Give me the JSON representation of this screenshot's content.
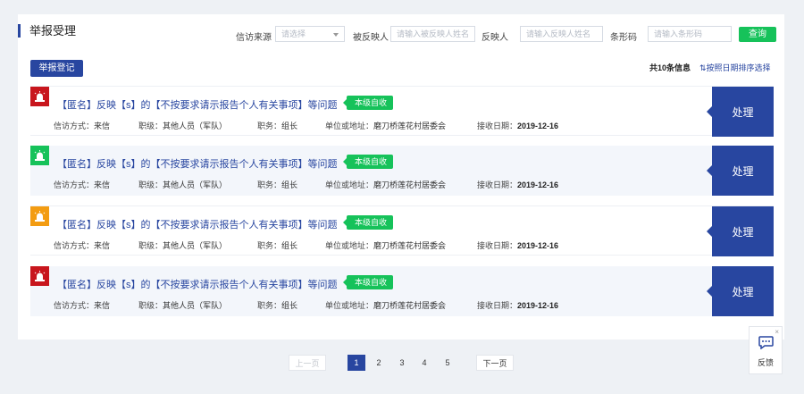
{
  "header": {
    "title": "举报受理"
  },
  "filters": {
    "source_label": "信访来源",
    "source_placeholder": "请选择",
    "reported_label": "被反映人",
    "reported_placeholder": "请输入被反映人姓名",
    "reporter_label": "反映人",
    "reporter_placeholder": "请输入反映人姓名",
    "barcode_label": "条形码",
    "barcode_placeholder": "请输入条形码",
    "query_label": "查询"
  },
  "toolbar": {
    "register_label": "举报登记",
    "total_info": "共10条信息",
    "sort_label": "按照日期排序选择"
  },
  "colors": {
    "red": "#c8161d",
    "green": "#16c25a",
    "orange": "#f39c12",
    "primary": "#2846a0"
  },
  "cards": [
    {
      "flag_color": "red",
      "title": "【匿名】反映【s】的【不按要求请示报告个人有关事项】等问题",
      "badge": "本级自收",
      "method_label": "信访方式：",
      "method": "来信",
      "rank_label": "职级：",
      "rank": "其他人员（军队）",
      "post_label": "职务：",
      "post": "组长",
      "unit_label": "单位或地址：",
      "unit": "磨刀桥莲花村居委会",
      "date_label": "接收日期：",
      "date": "2019-12-16",
      "action": "处理"
    },
    {
      "flag_color": "green",
      "title": "【匿名】反映【s】的【不按要求请示报告个人有关事项】等问题",
      "badge": "本级自收",
      "method_label": "信访方式：",
      "method": "来信",
      "rank_label": "职级：",
      "rank": "其他人员（军队）",
      "post_label": "职务：",
      "post": "组长",
      "unit_label": "单位或地址：",
      "unit": "磨刀桥莲花村居委会",
      "date_label": "接收日期：",
      "date": "2019-12-16",
      "action": "处理"
    },
    {
      "flag_color": "orange",
      "title": "【匿名】反映【s】的【不按要求请示报告个人有关事项】等问题",
      "badge": "本级自收",
      "method_label": "信访方式：",
      "method": "来信",
      "rank_label": "职级：",
      "rank": "其他人员（军队）",
      "post_label": "职务：",
      "post": "组长",
      "unit_label": "单位或地址：",
      "unit": "磨刀桥莲花村居委会",
      "date_label": "接收日期：",
      "date": "2019-12-16",
      "action": "处理"
    },
    {
      "flag_color": "red",
      "title": "【匿名】反映【s】的【不按要求请示报告个人有关事项】等问题",
      "badge": "本级自收",
      "method_label": "信访方式：",
      "method": "来信",
      "rank_label": "职级：",
      "rank": "其他人员（军队）",
      "post_label": "职务：",
      "post": "组长",
      "unit_label": "单位或地址：",
      "unit": "磨刀桥莲花村居委会",
      "date_label": "接收日期：",
      "date": "2019-12-16",
      "action": "处理"
    }
  ],
  "pagination": {
    "prev_label": "上一页",
    "pages": [
      "1",
      "2",
      "3",
      "4",
      "5"
    ],
    "current": "1",
    "next_label": "下一页"
  },
  "feedback": {
    "label": "反馈",
    "close": "×"
  }
}
